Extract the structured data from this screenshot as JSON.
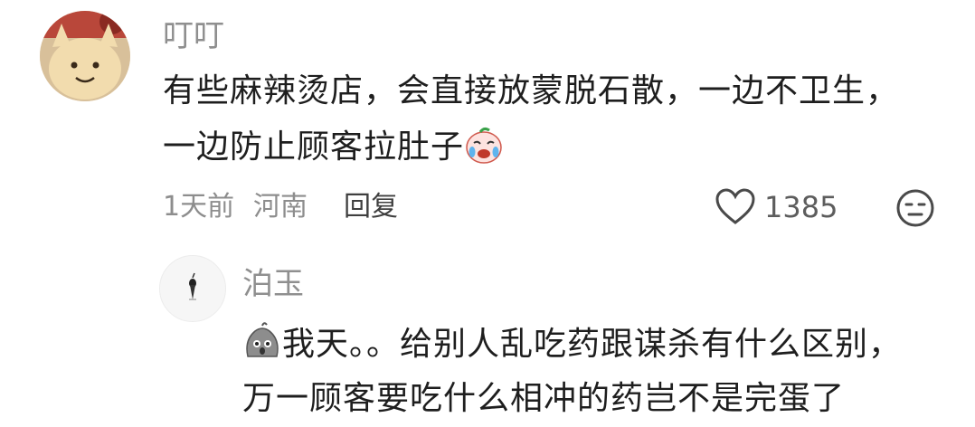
{
  "comment": {
    "author": "叮叮",
    "text_line1": "有些麻辣烫店，会直接放蒙脱石散，一边不卫生，",
    "text_line2": "一边防止顾客拉肚子",
    "time": "1天前",
    "location": "河南",
    "reply_label": "回复",
    "likes": "1385",
    "avatar_icon": "plush-toy-avatar",
    "emoji_icon": "crying-face-emoji"
  },
  "reply": {
    "author": "泊玉",
    "text_line1": "我天。。给别人乱吃药跟谋杀有什么区别，",
    "text_line2": "万一顾客要吃什么相冲的药岂不是完蛋了",
    "avatar_icon": "bird-avatar",
    "emoji_icon": "shocked-blob-emoji"
  },
  "icons": {
    "like": "heart-icon",
    "reaction": "neutral-face-icon"
  }
}
